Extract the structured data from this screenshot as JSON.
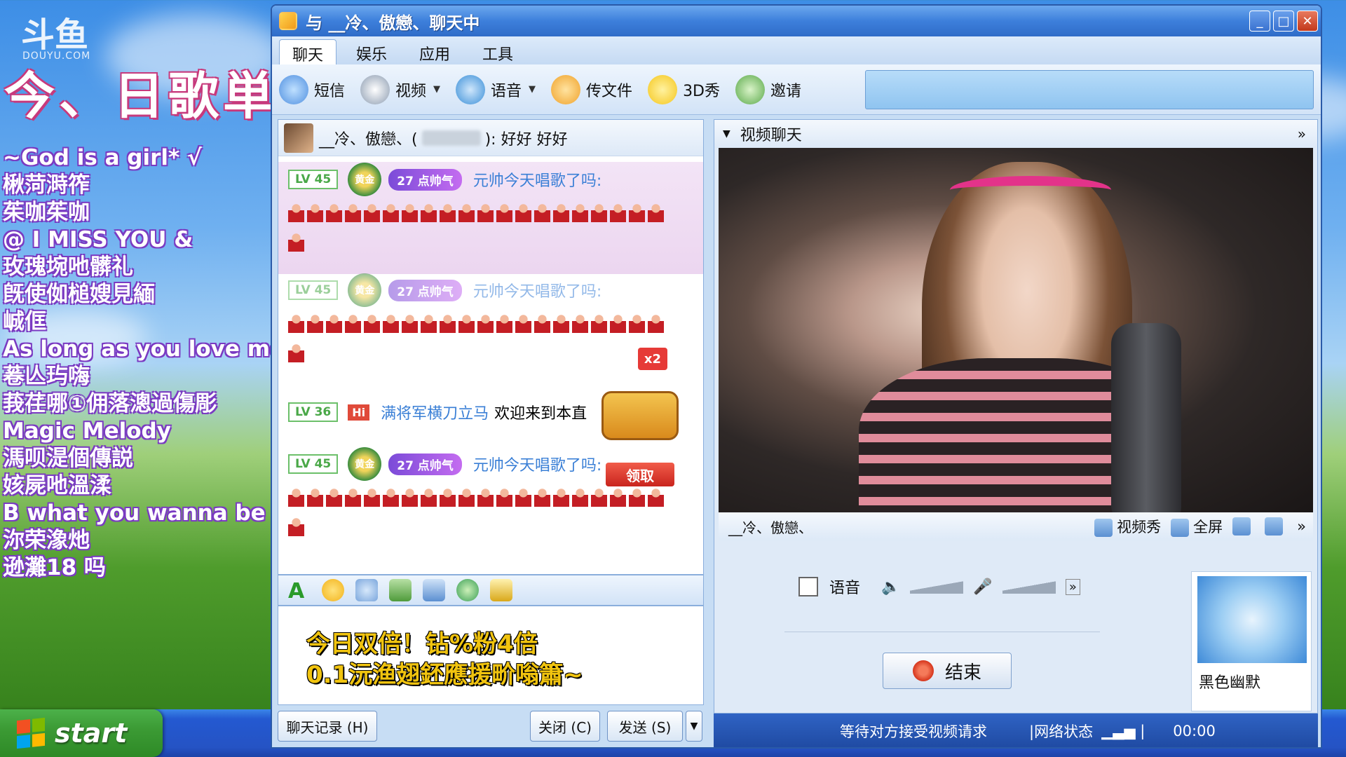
{
  "desktop": {
    "logo_text": "斗鱼",
    "logo_sub": "DOUYU.COM",
    "song_title": "今、日歌単",
    "songs": [
      "~God is a girl* √",
      "楸菏溡筰",
      "茱咖茱咖",
      "@ I MISS YOU &",
      "玫瑰埦吔髒礼",
      "旣使侞槌嫂見緬",
      "峸㑌",
      "As long as you love me",
      "菤亾玙嗨",
      "莪荏哪①佣落漗過傷彫",
      "Magic Melody",
      "溤呗湜個傳説",
      "姟屍吔溫渘",
      "B what you wanna be",
      "沵荣潒灺",
      "逊灘18 吗"
    ],
    "start_label": "start"
  },
  "window": {
    "title": "与 __冷、傲戀、聊天中",
    "menu": [
      "聊天",
      "娱乐",
      "应用",
      "工具"
    ],
    "toolbar": [
      {
        "label": "短信",
        "icon": "sms-icon",
        "color": "#4f8fe0"
      },
      {
        "label": "视频",
        "icon": "video-icon",
        "color": "#8b9bb0",
        "dropdown": true
      },
      {
        "label": "语音",
        "icon": "voice-icon",
        "color": "#3a8fd8",
        "dropdown": true
      },
      {
        "label": "传文件",
        "icon": "file-transfer-icon",
        "color": "#f0a22a"
      },
      {
        "label": "3D秀",
        "icon": "3d-show-icon",
        "color": "#f5c61c"
      },
      {
        "label": "邀请",
        "icon": "invite-icon",
        "color": "#5aa94a"
      }
    ]
  },
  "chat": {
    "header_name": "__冷、傲戀、(",
    "header_msg": "): 好好   好好",
    "messages": [
      {
        "lv": "LV 45",
        "medal": "黄金",
        "badge": "27 点帅气",
        "user": "元帅今天唱歌了吗:"
      },
      {
        "lv": "LV 45",
        "medal": "黄金",
        "badge": "27 点帅气",
        "user": "元帅今天唱歌了吗:"
      },
      {
        "lv": "LV 36",
        "hi": "Hi",
        "user": "满将军横刀立马",
        "text": "欢迎来到本直"
      },
      {
        "lv": "LV 45",
        "medal": "黄金",
        "badge": "27 点帅气",
        "user": "元帅今天唱歌了吗:"
      }
    ],
    "x2": "x2",
    "claim": "领取",
    "input_lines": [
      "今日双倍！钻%粉4倍",
      "0.1沅渔翅鉟應援畍嗡簫~"
    ],
    "btn_history": "聊天记录 (H)",
    "btn_close": "关闭 (C)",
    "btn_send": "发送 (S)"
  },
  "video": {
    "header": "视频聊天",
    "peer_label": "__冷、傲戀、",
    "sub_actions": [
      "视频秀",
      "全屏"
    ],
    "voice_label": "语音",
    "end_btn": "结束",
    "peer_name": "黑色幽默",
    "status": "等待对方接受视频请求",
    "net_label": "|网络状态",
    "timer": "00:00"
  }
}
